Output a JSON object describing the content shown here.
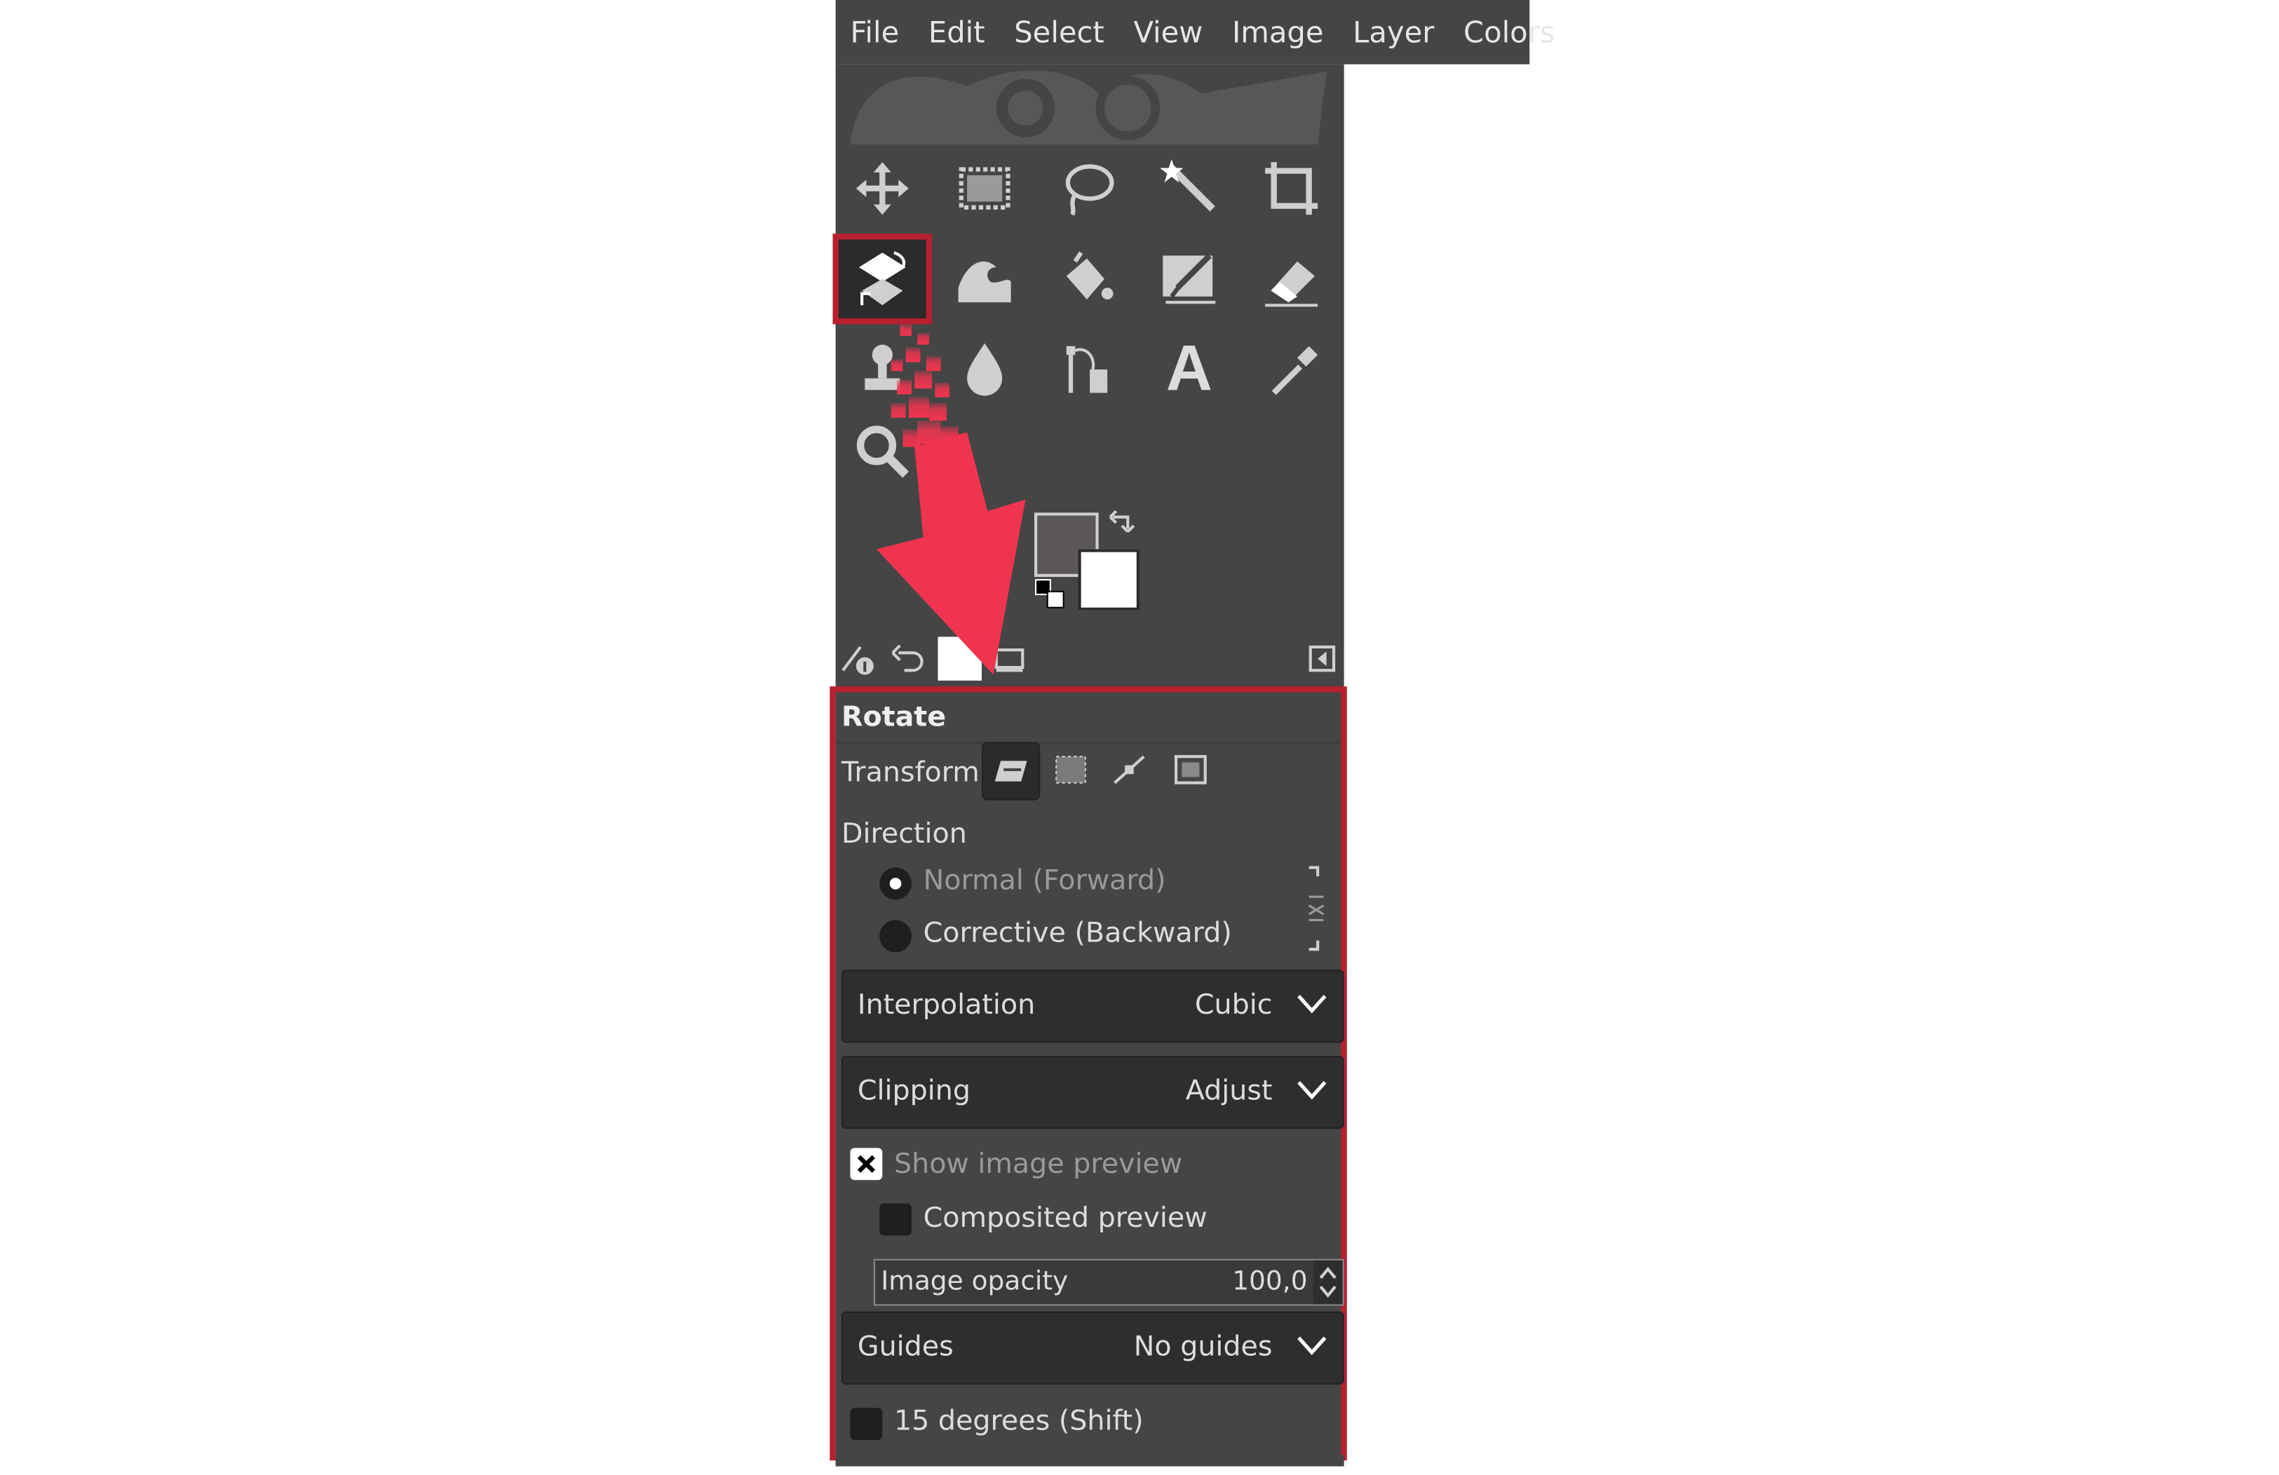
{
  "menubar": {
    "items": [
      "File",
      "Edit",
      "Select",
      "View",
      "Image",
      "Layer",
      "Colors"
    ]
  },
  "toolbox": {
    "tools": [
      {
        "name": "move-tool-icon"
      },
      {
        "name": "rect-select-tool-icon"
      },
      {
        "name": "free-select-tool-icon"
      },
      {
        "name": "fuzzy-select-tool-icon"
      },
      {
        "name": "crop-tool-icon"
      },
      {
        "name": "unified-transform-tool-icon",
        "selected": true
      },
      {
        "name": "warp-transform-tool-icon"
      },
      {
        "name": "bucket-fill-tool-icon"
      },
      {
        "name": "paintbrush-tool-icon"
      },
      {
        "name": "eraser-tool-icon"
      },
      {
        "name": "clone-tool-icon"
      },
      {
        "name": "smudge-tool-icon"
      },
      {
        "name": "paths-tool-icon"
      },
      {
        "name": "text-tool-icon"
      },
      {
        "name": "color-picker-tool-icon"
      },
      {
        "name": "zoom-tool-icon"
      }
    ],
    "text_tool_glyph": "A",
    "fg_color": "#5b5658",
    "bg_color": "#ffffff"
  },
  "options": {
    "title": "Rotate",
    "transform_label": "Transform:",
    "direction_label": "Direction",
    "direction_normal": "Normal (Forward)",
    "direction_corrective": "Corrective (Backward)",
    "interpolation_label": "Interpolation",
    "interpolation_value": "Cubic",
    "clipping_label": "Clipping",
    "clipping_value": "Adjust",
    "show_preview_label": "Show image preview",
    "composited_preview_label": "Composited preview",
    "opacity_label": "Image opacity",
    "opacity_value": "100,0",
    "guides_label": "Guides",
    "guides_value": "No guides",
    "fifteen_degrees_label": "15 degrees (Shift)"
  },
  "colors": {
    "accent": "#b8202f",
    "arrow": "#f0344f",
    "panel": "#454545",
    "dark": "#2e2e2e"
  }
}
